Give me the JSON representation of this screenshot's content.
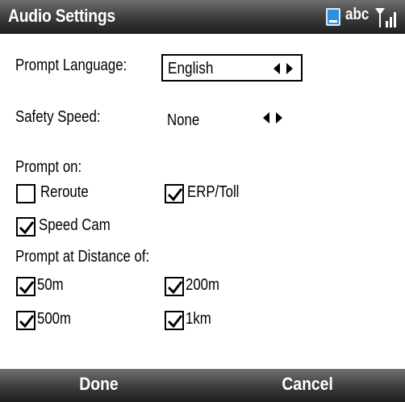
{
  "title_bar": {
    "title": "Audio Settings",
    "status_text": "abc",
    "icons": [
      "document-icon",
      "signal-strength-icon"
    ]
  },
  "prompt_language": {
    "label": "Prompt Language:",
    "value": "English"
  },
  "safety_speed": {
    "label": "Safety Speed:",
    "value": "None"
  },
  "prompt_on": {
    "heading": "Prompt on:",
    "options": [
      {
        "label": "Reroute",
        "checked": false
      },
      {
        "label": "ERP/Toll",
        "checked": true
      },
      {
        "label": "Speed Cam",
        "checked": true
      }
    ]
  },
  "prompt_distance": {
    "heading": "Prompt at Distance of:",
    "options": [
      {
        "label": "50m",
        "checked": true
      },
      {
        "label": "200m",
        "checked": true
      },
      {
        "label": "500m",
        "checked": true
      },
      {
        "label": "1km",
        "checked": true
      }
    ]
  },
  "softkeys": {
    "left": "Done",
    "right": "Cancel"
  },
  "colors": {
    "bar_gradient_top": "#6f6f6f",
    "bar_gradient_bottom": "#1f1f1f",
    "doc_icon": "#2f8fe0",
    "background": "#ffffff",
    "text": "#000000"
  }
}
